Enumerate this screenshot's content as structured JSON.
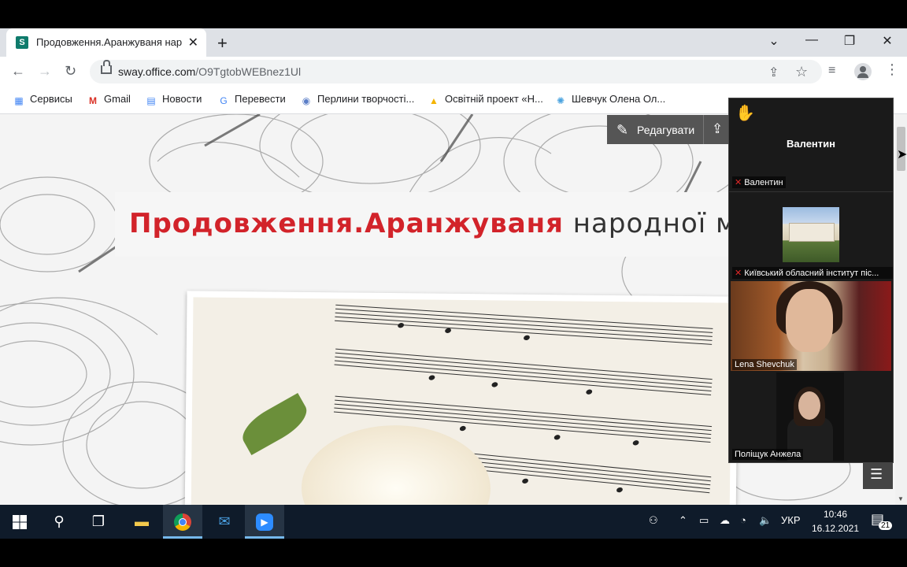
{
  "browser": {
    "tab_title": "Продовження.Аранжуваня нар",
    "tab_favicon": "S",
    "new_tab": "+",
    "url_host": "sway.office.com",
    "url_path": "/O9TgtobWEBnez1Ul",
    "bookmarks": [
      {
        "label": "Сервисы",
        "icon": "apps-grid-icon",
        "color": "#4285f4"
      },
      {
        "label": "Gmail",
        "icon": "gmail-icon",
        "color": "#d93025"
      },
      {
        "label": "Новости",
        "icon": "news-icon",
        "color": "#4285f4"
      },
      {
        "label": "Перевести",
        "icon": "translate-icon",
        "color": "#4285f4"
      },
      {
        "label": "Перлини творчості...",
        "icon": "site-icon",
        "color": "#5b7ec7"
      },
      {
        "label": "Освітній проект «Н...",
        "icon": "site-icon",
        "color": "#f4b400"
      },
      {
        "label": "Шевчук Олена Ол...",
        "icon": "site-icon",
        "color": "#4aa3df"
      }
    ]
  },
  "sway": {
    "title_red": "Продовження.Аранжуваня",
    "title_dark": " народної муз",
    "edit_label": "Редагувати"
  },
  "zoom": {
    "active_speaker": "Валентин",
    "participants": [
      {
        "name": "Валентин",
        "muted": true
      },
      {
        "name": "Київський обласний інститут піс...",
        "muted": true
      },
      {
        "name": "Lena Shevchuk",
        "muted": false
      },
      {
        "name": "Поліщук Анжела",
        "muted": false
      }
    ]
  },
  "taskbar": {
    "language": "УКР",
    "time": "10:46",
    "date": "16.12.2021",
    "notifications": "21"
  }
}
